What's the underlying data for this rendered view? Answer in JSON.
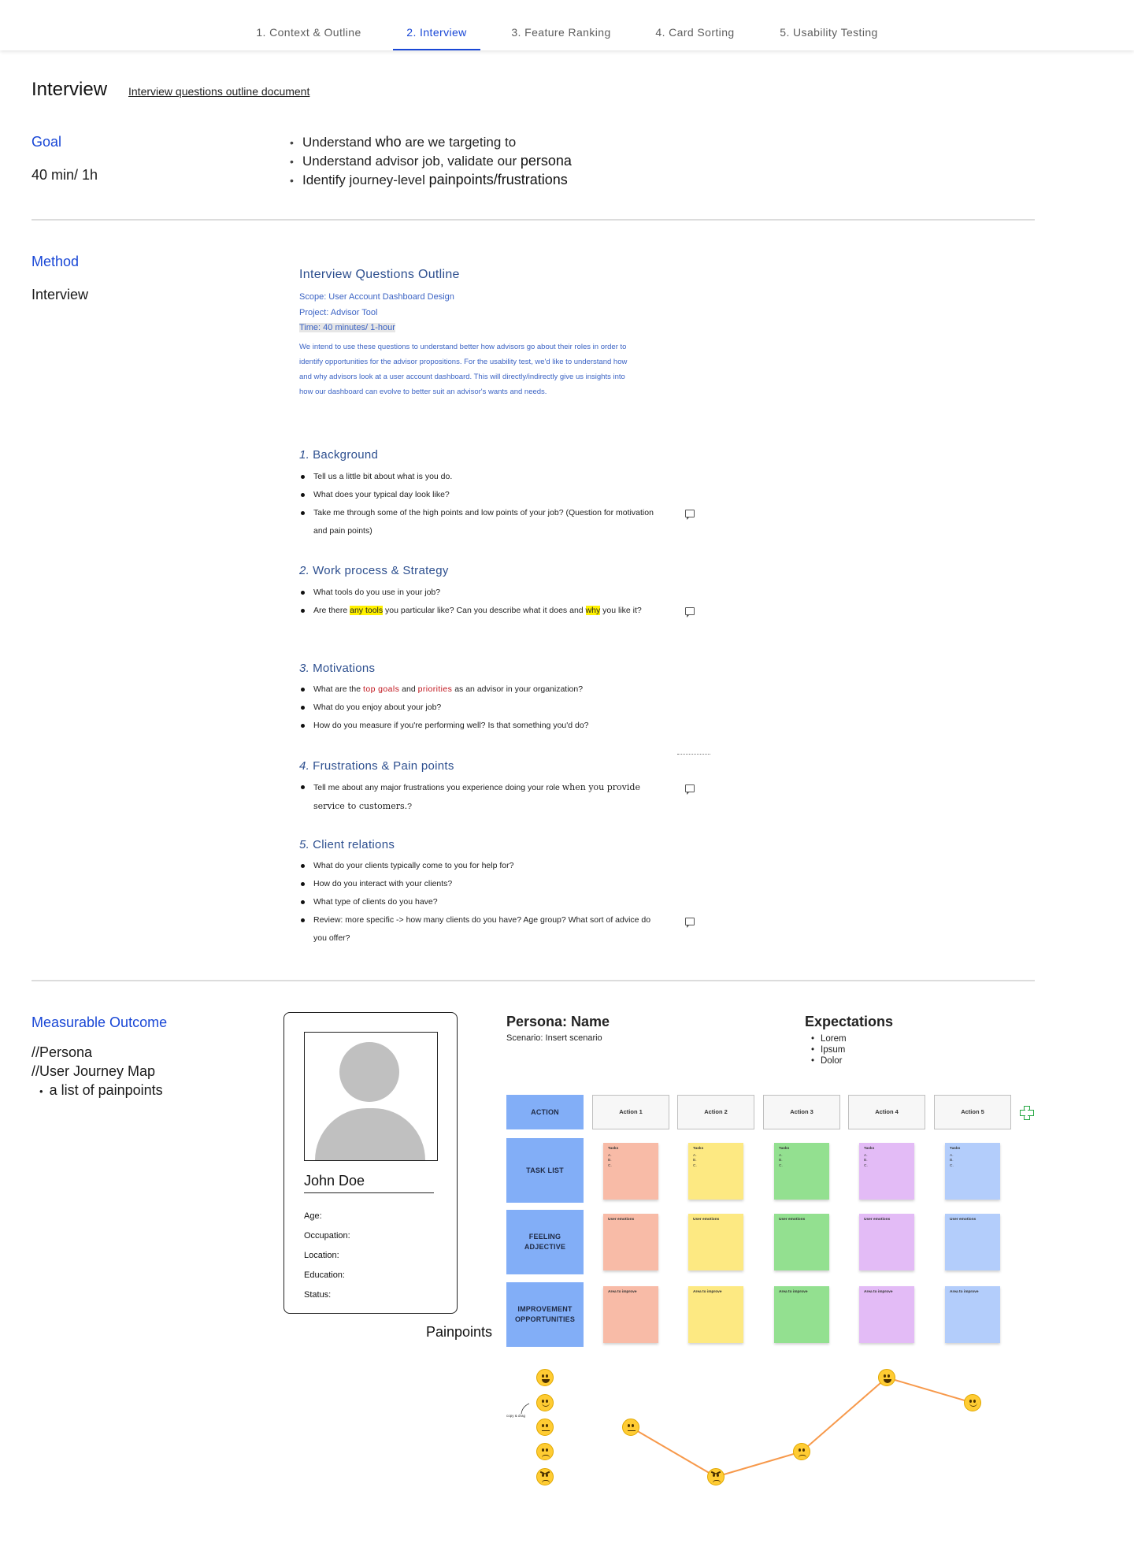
{
  "nav": {
    "tabs": [
      "1. Context & Outline",
      "2. Interview",
      "3. Feature Ranking",
      "4. Card Sorting",
      "5. Usability Testing"
    ],
    "active": 1
  },
  "page": {
    "title": "Interview",
    "doc_link": "Interview questions outline document"
  },
  "goal": {
    "label": "Goal",
    "duration": "40 min/ 1h",
    "items": [
      {
        "pre": "Understand ",
        "bold": "who",
        "post": " are we targeting to"
      },
      {
        "pre": "Understand advisor job, validate our ",
        "bold": "persona",
        "post": ""
      },
      {
        "pre": "Identify journey-level ",
        "bold": "painpoints/frustrations",
        "post": ""
      }
    ]
  },
  "method": {
    "label": "Method",
    "value": "Interview"
  },
  "doc": {
    "title": "Interview Questions Outline",
    "scope": "Scope: User Account Dashboard Design",
    "project": "Project: Advisor Tool",
    "time_prefix": "Time: 40 minutes/ ",
    "time_hl": "1-hour",
    "intro": "We intend to use these questions to understand better how advisors go about their roles in order to identify opportunities for the advisor propositions. For the usability test, we'd like to understand how and why advisors look at a user account dashboard. This will directly/indirectly give us insights into how our dashboard can evolve to better suit an advisor's wants and needs.",
    "sections": [
      {
        "num": "1.",
        "title": "Background"
      },
      {
        "num": "2.",
        "title": "Work process & Strategy"
      },
      {
        "num": "3.",
        "title": "Motivations"
      },
      {
        "num": "4.",
        "title": "Frustrations & Pain points"
      },
      {
        "num": "5.",
        "title": "Client relations"
      }
    ],
    "q": {
      "bg1": "Tell us a little bit about what is you do.",
      "bg2": "What does your typical day look like?",
      "bg3": "Take me through some of the high points and low points of your job? (Question for motivation and pain points)",
      "wp1": "What tools do you use in your job?",
      "wp2_a": "Are there ",
      "wp2_b": "any tools",
      "wp2_c": " you particular like? Can you describe what it does and ",
      "wp2_d": "why",
      "wp2_e": " you like it?",
      "mo1_a": "What are the ",
      "mo1_b": "top goals",
      "mo1_c": " and ",
      "mo1_d": "priorities",
      "mo1_e": " as an advisor in your organization?",
      "mo2": "What do you enjoy about your job?",
      "mo3": "How do you measure if you're performing well? Is that something you'd do?",
      "fr1_a": "Tell me about any major frustrations you experience doing your role ",
      "fr1_b": "when you provide service to customers.",
      "fr1_c": "?",
      "cr1": "What do your clients typically come to you for help for?",
      "cr2": "How do you interact with your clients?",
      "cr3": "What type of clients do you have?",
      "cr4": "Review: more specific -> how many clients do you have? Age group? What sort of advice do you offer?"
    }
  },
  "outcome": {
    "label": "Measurable Outcome",
    "line1": "//Persona",
    "line2": "//User Journey Map",
    "bullet": "a list of painpoints"
  },
  "persona_card": {
    "name": "John Doe",
    "fields": [
      "Age:",
      "Occupation:",
      "Location:",
      "Education:",
      "Status:"
    ]
  },
  "journey": {
    "persona_title": "Persona: Name",
    "scenario": "Scenario: Insert scenario",
    "expectations_title": "Expectations",
    "expectations": [
      "Lorem",
      "Ipsum",
      "Dolor"
    ],
    "row_heads": [
      "ACTION",
      "TASK LIST",
      "FEELING ADJECTIVE",
      "IMPROVEMENT OPPORTUNITIES"
    ],
    "actions": [
      "Action 1",
      "Action 2",
      "Action 3",
      "Action 4",
      "Action 5"
    ],
    "task_label": "Tasks",
    "task_lines": "A.\nB.\nC.",
    "feeling_label": "User emotions",
    "improve_label": "Area to improve",
    "sticky_colors": [
      "#f8bba7",
      "#fde982",
      "#93e090",
      "#e3bbf6",
      "#b3cdfb"
    ],
    "painpoints_title": "Painpoints",
    "copy_note": "copy & drag",
    "scale": [
      "very-happy-face-icon",
      "happy-face-icon",
      "neutral-face-icon",
      "sad-face-icon",
      "angry-face-icon"
    ],
    "curve_levels": [
      3,
      1,
      2,
      5,
      4
    ],
    "curve_color": "#f7994b"
  },
  "colors": {
    "accent": "#1947d6",
    "row_head": "#82aef7"
  }
}
